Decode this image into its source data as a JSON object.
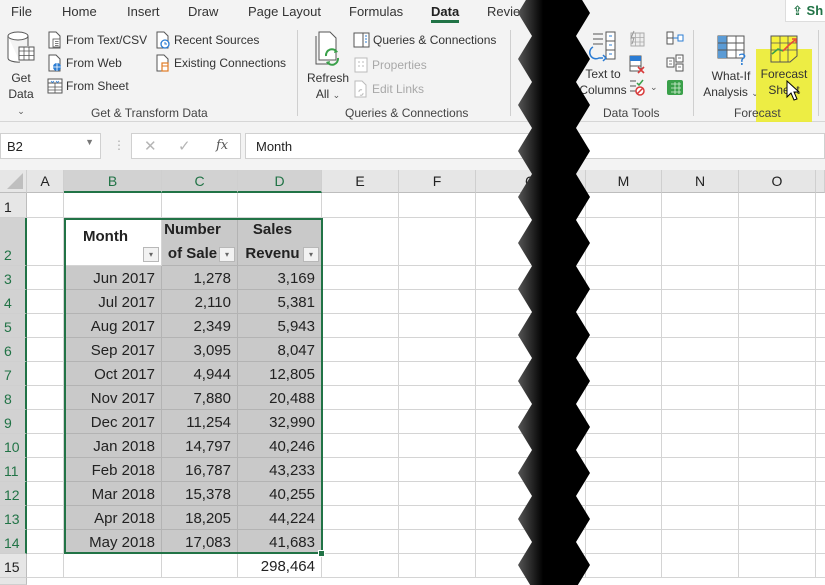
{
  "tabs": [
    {
      "label": "File",
      "active": false
    },
    {
      "label": "Home",
      "active": false
    },
    {
      "label": "Insert",
      "active": false
    },
    {
      "label": "Draw",
      "active": false
    },
    {
      "label": "Page Layout",
      "active": false
    },
    {
      "label": "Formulas",
      "active": false
    },
    {
      "label": "Data",
      "active": true
    },
    {
      "label": "Review",
      "active": false
    }
  ],
  "share_label": "Sh",
  "ribbon": {
    "get_transform": {
      "group_label": "Get & Transform Data",
      "get_data": {
        "line1": "Get",
        "line2": "Data"
      },
      "from_text_csv": "From Text/CSV",
      "from_web": "From Web",
      "from_sheet": "From Sheet",
      "recent_sources": "Recent Sources",
      "existing_connections": "Existing Connections"
    },
    "queries": {
      "group_label": "Queries & Connections",
      "refresh_all": {
        "line1": "Refresh",
        "line2": "All"
      },
      "queries_connections": "Queries & Connections",
      "properties": "Properties",
      "edit_links": "Edit Links"
    },
    "data_tools": {
      "group_label": "Data Tools",
      "text_to_columns": {
        "line1": "Text to",
        "line2": "Columns"
      }
    },
    "forecast": {
      "group_label": "Forecast",
      "what_if": {
        "line1": "What-If",
        "line2": "Analysis"
      },
      "forecast_sheet": {
        "line1": "Forecast",
        "line2": "Sheet"
      },
      "highlight_color": "#ecec3a"
    }
  },
  "formula_bar": {
    "name_box": "B2",
    "cancel_icon": "✕",
    "enter_icon": "✓",
    "fx_label": "fx",
    "value": "Month"
  },
  "columns": [
    "A",
    "B",
    "C",
    "D",
    "E",
    "F",
    "G",
    "M",
    "N",
    "O"
  ],
  "selected_columns": [
    "B",
    "C",
    "D"
  ],
  "rows": [
    "1",
    "2",
    "3",
    "4",
    "5",
    "6",
    "7",
    "8",
    "9",
    "10",
    "11",
    "12",
    "13",
    "14",
    "15"
  ],
  "table": {
    "headers": [
      {
        "line1": "Month",
        "line2": ""
      },
      {
        "line1": "Number",
        "line2": "of Sale"
      },
      {
        "line1": "Sales",
        "line2": "Revenu"
      }
    ],
    "rows": [
      [
        "Jun 2017",
        "1,278",
        "3,169"
      ],
      [
        "Jul 2017",
        "2,110",
        "5,381"
      ],
      [
        "Aug 2017",
        "2,349",
        "5,943"
      ],
      [
        "Sep 2017",
        "3,095",
        "8,047"
      ],
      [
        "Oct 2017",
        "4,944",
        "12,805"
      ],
      [
        "Nov 2017",
        "7,880",
        "20,488"
      ],
      [
        "Dec 2017",
        "11,254",
        "32,990"
      ],
      [
        "Jan 2018",
        "14,797",
        "40,246"
      ],
      [
        "Feb 2018",
        "16,787",
        "43,233"
      ],
      [
        "Mar 2018",
        "15,378",
        "40,255"
      ],
      [
        "Apr 2018",
        "18,205",
        "44,224"
      ],
      [
        "May 2018",
        "17,083",
        "41,683"
      ]
    ],
    "total": "298,464"
  },
  "colors": {
    "excel_green": "#217346",
    "table_shade": "#c9c9c9"
  }
}
